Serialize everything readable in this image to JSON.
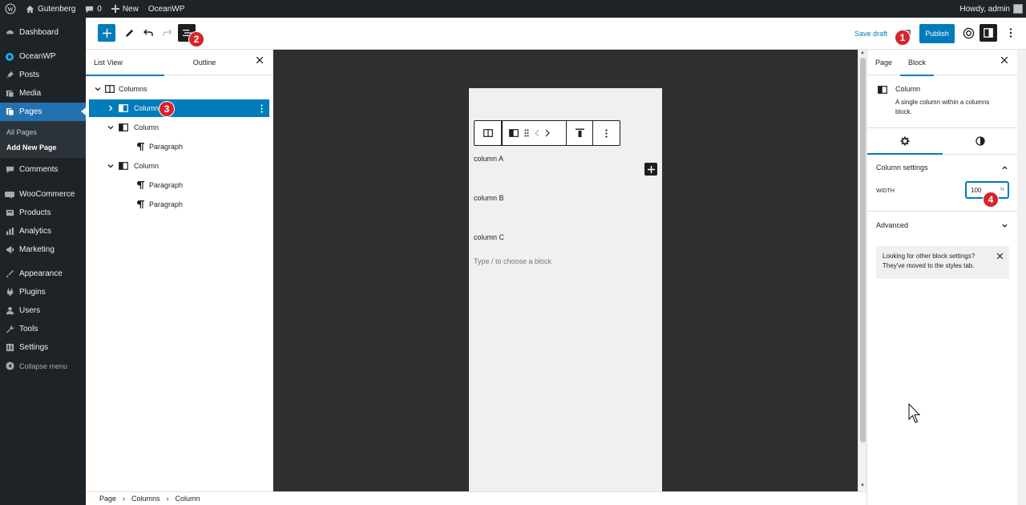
{
  "admin_bar": {
    "site_name": "Gutenberg",
    "comments_count": "0",
    "new_label": "New",
    "theme_label": "OceanWP",
    "howdy": "Howdy, admin"
  },
  "admin_menu": {
    "items": [
      {
        "label": "Dashboard",
        "icon": "dashboard-icon"
      },
      {
        "label": "OceanWP",
        "icon": "oceanwp-icon"
      },
      {
        "label": "Posts",
        "icon": "pin-icon"
      },
      {
        "label": "Media",
        "icon": "media-icon"
      },
      {
        "label": "Pages",
        "icon": "pages-icon"
      },
      {
        "label": "Comments",
        "icon": "comments-icon"
      },
      {
        "label": "WooCommerce",
        "icon": "woocommerce-icon"
      },
      {
        "label": "Products",
        "icon": "products-icon"
      },
      {
        "label": "Analytics",
        "icon": "analytics-icon"
      },
      {
        "label": "Marketing",
        "icon": "marketing-icon"
      },
      {
        "label": "Appearance",
        "icon": "appearance-icon"
      },
      {
        "label": "Plugins",
        "icon": "plugins-icon"
      },
      {
        "label": "Users",
        "icon": "users-icon"
      },
      {
        "label": "Tools",
        "icon": "tools-icon"
      },
      {
        "label": "Settings",
        "icon": "settings-icon"
      }
    ],
    "submenu": [
      "All Pages",
      "Add New Page"
    ],
    "collapse": "Collapse menu"
  },
  "header": {
    "save_draft": "Save draft",
    "publish": "Publish"
  },
  "badges": [
    "1",
    "2",
    "3",
    "4"
  ],
  "list_view": {
    "tabs": [
      "List View",
      "Outline"
    ],
    "rows": [
      {
        "label": "Columns"
      },
      {
        "label": "Column"
      },
      {
        "label": "Column"
      },
      {
        "label": "Paragraph"
      },
      {
        "label": "Column"
      },
      {
        "label": "Paragraph"
      },
      {
        "label": "Paragraph"
      }
    ]
  },
  "canvas": {
    "columns": [
      "column A",
      "column B",
      "column C"
    ],
    "placeholder": "Type / to choose a block"
  },
  "sidebar": {
    "tabs": [
      "Page",
      "Block"
    ],
    "block_title": "Column",
    "block_desc": "A single column within a columns block.",
    "column_settings": "Column settings",
    "width_label": "WIDTH",
    "width_value": "100",
    "width_unit": "%",
    "advanced": "Advanced",
    "notice": "Looking for other block settings? They've moved to the styles tab."
  },
  "breadcrumb": [
    "Page",
    "Columns",
    "Column"
  ],
  "colors": {
    "accent": "#007cba",
    "admin_bg": "#1d2327",
    "badge": "#d8232a",
    "canvas_bg": "#2f2f2f"
  }
}
